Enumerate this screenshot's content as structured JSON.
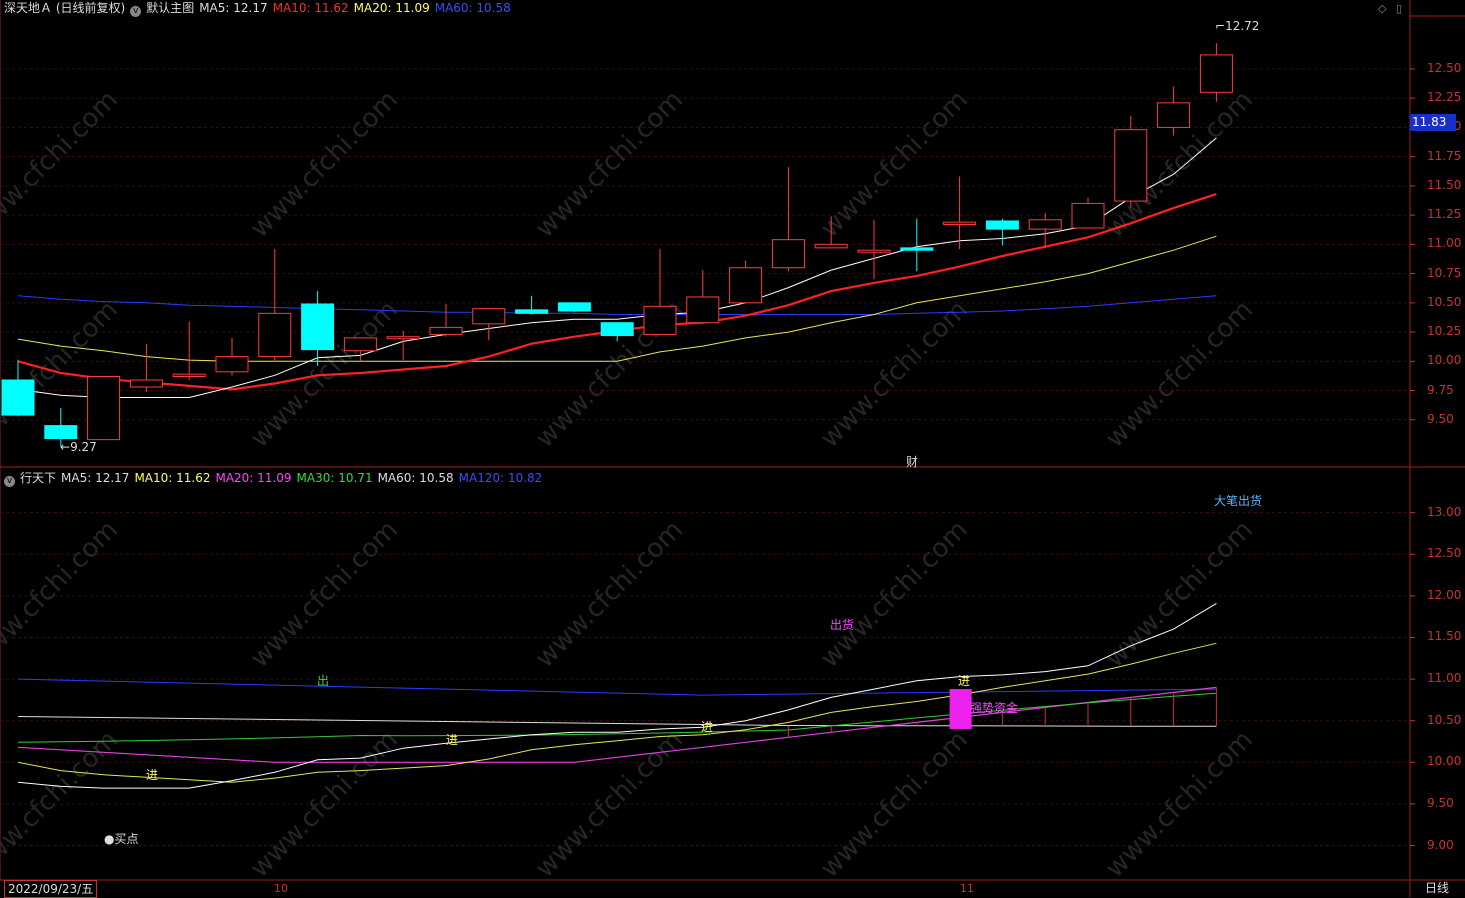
{
  "top": {
    "title": "深天地Ａ (日线前复权)",
    "theme": "默认主图",
    "ma": [
      {
        "label": "MA5: 12.17",
        "color": "#ffffff"
      },
      {
        "label": "MA10: 11.62",
        "color": "#ff2a2a"
      },
      {
        "label": "MA20: 11.09",
        "color": "#ffff55"
      },
      {
        "label": "MA60: 10.58",
        "color": "#3a4cff"
      }
    ],
    "axis": [
      "12.50",
      "12.25",
      "12.00",
      "11.75",
      "11.50",
      "11.25",
      "11.00",
      "10.75",
      "10.50",
      "10.25",
      "10.00",
      "9.75",
      "9.50"
    ],
    "current_price": "11.83",
    "high_marker": "12.72",
    "low_marker": "9.27",
    "cai_label": "财"
  },
  "bottom": {
    "title": "行天下",
    "ma": [
      {
        "label": "MA5: 12.17",
        "color": "#dddddd"
      },
      {
        "label": "MA10: 11.62",
        "color": "#ffff55"
      },
      {
        "label": "MA20: 11.09",
        "color": "#ff44ff"
      },
      {
        "label": "MA30: 10.71",
        "color": "#33dd33"
      },
      {
        "label": "MA60: 10.58",
        "color": "#dddddd"
      },
      {
        "label": "MA120: 10.82",
        "color": "#3a4cff"
      }
    ],
    "axis": [
      "13.00",
      "12.50",
      "12.00",
      "11.50",
      "11.00",
      "10.50",
      "10.00",
      "9.50",
      "9.00"
    ],
    "signals": {
      "big_sell": "大笔出货",
      "out_goods": "出货",
      "out1": "出",
      "jin1": "进",
      "jin2": "进",
      "jin3": "进",
      "jin4": "进",
      "buy_point": "买点",
      "pink_text": "强势资金"
    }
  },
  "footer": {
    "date": "2022/09/23/五",
    "month_10": "10",
    "month_11": "11",
    "period": "日线"
  },
  "watermark": "www.cfchi.com",
  "chart_data": {
    "type": "candlestick",
    "candles": [
      {
        "o": 9.84,
        "h": 10.01,
        "l": 9.53,
        "c": 9.54
      },
      {
        "o": 9.45,
        "h": 9.6,
        "l": 9.27,
        "c": 9.34
      },
      {
        "o": 9.33,
        "h": 9.87,
        "l": 9.33,
        "c": 9.87
      },
      {
        "o": 9.78,
        "h": 10.15,
        "l": 9.74,
        "c": 9.84
      },
      {
        "o": 9.87,
        "h": 10.34,
        "l": 9.84,
        "c": 9.89
      },
      {
        "o": 9.91,
        "h": 10.2,
        "l": 9.88,
        "c": 10.04
      },
      {
        "o": 10.04,
        "h": 10.96,
        "l": 10.0,
        "c": 10.41
      },
      {
        "o": 10.49,
        "h": 10.6,
        "l": 9.96,
        "c": 10.1
      },
      {
        "o": 10.09,
        "h": 10.2,
        "l": 10.0,
        "c": 10.2
      },
      {
        "o": 10.2,
        "h": 10.26,
        "l": 10.01,
        "c": 10.21
      },
      {
        "o": 10.23,
        "h": 10.49,
        "l": 10.21,
        "c": 10.29
      },
      {
        "o": 10.32,
        "h": 10.45,
        "l": 10.18,
        "c": 10.45
      },
      {
        "o": 10.44,
        "h": 10.56,
        "l": 10.4,
        "c": 10.41
      },
      {
        "o": 10.5,
        "h": 10.5,
        "l": 10.42,
        "c": 10.43
      },
      {
        "o": 10.33,
        "h": 10.33,
        "l": 10.17,
        "c": 10.22
      },
      {
        "o": 10.23,
        "h": 10.96,
        "l": 10.23,
        "c": 10.47
      },
      {
        "o": 10.33,
        "h": 10.78,
        "l": 10.33,
        "c": 10.55
      },
      {
        "o": 10.5,
        "h": 10.86,
        "l": 10.5,
        "c": 10.8
      },
      {
        "o": 10.8,
        "h": 11.66,
        "l": 10.77,
        "c": 11.04
      },
      {
        "o": 10.97,
        "h": 11.24,
        "l": 10.97,
        "c": 11.0
      },
      {
        "o": 10.94,
        "h": 11.21,
        "l": 10.7,
        "c": 10.95
      },
      {
        "o": 10.97,
        "h": 11.22,
        "l": 10.77,
        "c": 10.95
      },
      {
        "o": 11.17,
        "h": 11.58,
        "l": 10.96,
        "c": 11.19
      },
      {
        "o": 11.2,
        "h": 11.22,
        "l": 10.99,
        "c": 11.13
      },
      {
        "o": 11.13,
        "h": 11.27,
        "l": 10.97,
        "c": 11.21
      },
      {
        "o": 11.14,
        "h": 11.4,
        "l": 11.14,
        "c": 11.35
      },
      {
        "o": 11.37,
        "h": 12.1,
        "l": 11.32,
        "c": 11.98
      },
      {
        "o": 12.0,
        "h": 12.35,
        "l": 11.93,
        "c": 12.21
      },
      {
        "o": 12.3,
        "h": 12.72,
        "l": 12.22,
        "c": 12.62
      }
    ],
    "up_color": "#ff3c3c",
    "down_color": "#00ffff",
    "ma5": [
      9.76,
      9.71,
      9.69,
      9.69,
      9.69,
      9.78,
      9.88,
      10.03,
      10.05,
      10.17,
      10.23,
      10.28,
      10.33,
      10.36,
      10.36,
      10.4,
      10.42,
      10.5,
      10.63,
      10.78,
      10.88,
      10.98,
      11.03,
      11.05,
      11.09,
      11.16,
      11.4,
      11.6,
      11.91
    ],
    "ma10": [
      10.0,
      9.9,
      9.85,
      9.82,
      9.79,
      9.76,
      9.81,
      9.88,
      9.9,
      9.93,
      9.96,
      10.04,
      10.15,
      10.21,
      10.26,
      10.31,
      10.33,
      10.39,
      10.48,
      10.6,
      10.67,
      10.73,
      10.81,
      10.9,
      10.98,
      11.06,
      11.18,
      11.31,
      11.43
    ],
    "ma20": [
      10.19,
      10.13,
      10.09,
      10.04,
      10.01,
      10.0,
      10.0,
      10.0,
      10.0,
      10.0,
      10.0,
      10.0,
      10.0,
      10.0,
      10.0,
      10.08,
      10.13,
      10.2,
      10.25,
      10.33,
      10.4,
      10.5,
      10.56,
      10.62,
      10.68,
      10.75,
      10.85,
      10.95,
      11.07
    ],
    "ma60": [
      10.56,
      10.53,
      10.51,
      10.5,
      10.48,
      10.47,
      10.46,
      10.45,
      10.44,
      10.43,
      10.42,
      10.42,
      10.41,
      10.41,
      10.4,
      10.4,
      10.4,
      10.4,
      10.4,
      10.4,
      10.4,
      10.41,
      10.42,
      10.43,
      10.45,
      10.47,
      10.5,
      10.53,
      10.56
    ],
    "y_range": [
      9.25,
      12.85
    ]
  }
}
